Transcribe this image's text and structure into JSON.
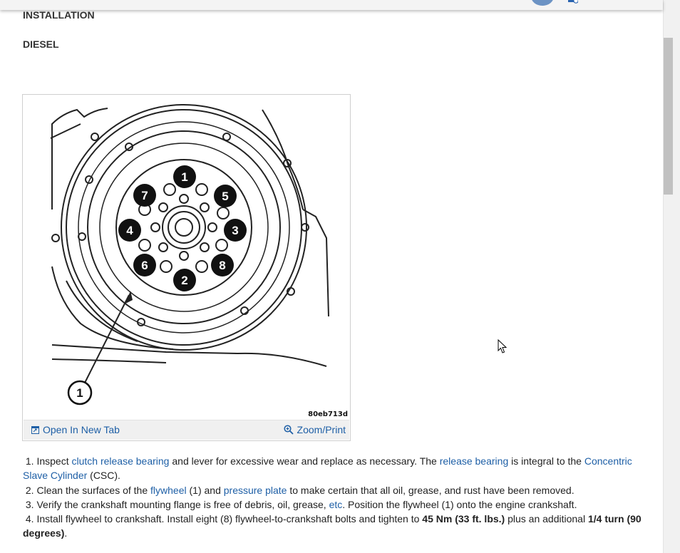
{
  "header": {
    "sections": [
      "INSTALLATION",
      "DIESEL"
    ]
  },
  "figure": {
    "code": "80eb713d",
    "callouts": [
      "1",
      "2",
      "3",
      "4",
      "5",
      "6",
      "7",
      "8"
    ],
    "open_new_tab": "Open In New Tab",
    "zoom_print": "Zoom/Print"
  },
  "steps": [
    {
      "n": "1.",
      "parts": [
        {
          "t": "Inspect "
        },
        {
          "t": "clutch release bearing",
          "link": true
        },
        {
          "t": " and lever for excessive wear and replace as necessary. The "
        },
        {
          "t": "release bearing",
          "link": true
        },
        {
          "t": " is integral to the "
        },
        {
          "t": "Concentric Slave Cylinder",
          "link": true
        },
        {
          "t": " (CSC)."
        }
      ]
    },
    {
      "n": "2.",
      "parts": [
        {
          "t": "Clean the surfaces of the "
        },
        {
          "t": "flywheel",
          "link": true
        },
        {
          "t": " (1) and "
        },
        {
          "t": "pressure plate",
          "link": true
        },
        {
          "t": " to make certain that all oil, grease, and rust have been removed."
        }
      ]
    },
    {
      "n": "3.",
      "parts": [
        {
          "t": "Verify the crankshaft mounting flange is free of debris, oil, grease, "
        },
        {
          "t": "etc",
          "link": true
        },
        {
          "t": ". Position the flywheel (1) onto the engine crankshaft."
        }
      ]
    },
    {
      "n": "4.",
      "parts": [
        {
          "t": "Install flywheel to crankshaft. Install eight (8) flywheel-to-crankshaft bolts and tighten to "
        },
        {
          "t": "45 Nm (33 ft. lbs.)",
          "bold": true
        },
        {
          "t": " plus an additional "
        },
        {
          "t": "1/4 turn (90 degrees)",
          "bold": true
        },
        {
          "t": "."
        }
      ]
    }
  ],
  "colors": {
    "link": "#1e5fa6",
    "avatar": "#6c93c4"
  },
  "icons": [
    "open-new-tab-icon",
    "zoom-icon",
    "mouse-cursor-icon"
  ]
}
